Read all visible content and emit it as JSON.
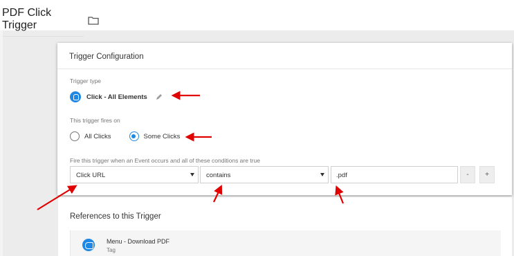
{
  "header": {
    "title": "PDF Click Trigger",
    "folder_icon": "folder-icon"
  },
  "config": {
    "heading": "Trigger Configuration",
    "trigger_type_label": "Trigger type",
    "trigger_type_value": "Click - All Elements",
    "fires_on_label": "This trigger fires on",
    "radio_all": "All Clicks",
    "radio_some": "Some Clicks",
    "selected_radio": "Some Clicks",
    "condition_label": "Fire this trigger when an Event occurs and all of these conditions are true",
    "condition": {
      "variable": "Click URL",
      "operator": "contains",
      "value": ".pdf"
    },
    "minus_label": "-",
    "plus_label": "+"
  },
  "references": {
    "heading": "References to this Trigger",
    "items": [
      {
        "name": "Menu - Download PDF",
        "type": "Tag"
      }
    ]
  },
  "colors": {
    "accent": "#1e88e5",
    "annotation_arrow": "#e10000"
  }
}
